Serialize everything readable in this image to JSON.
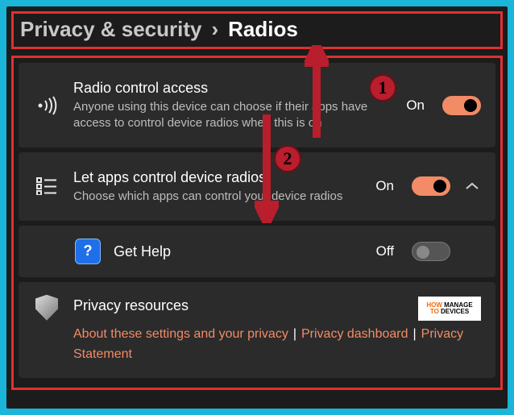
{
  "breadcrumb": {
    "parent": "Privacy & security",
    "separator": "›",
    "current": "Radios"
  },
  "rows": {
    "radio_access": {
      "title": "Radio control access",
      "sub": "Anyone using this device can choose if their apps have access to control device radios when this is on",
      "state_label": "On"
    },
    "let_apps": {
      "title": "Let apps control device radios",
      "sub": "Choose which apps can control your device radios",
      "state_label": "On"
    },
    "get_help": {
      "title": "Get Help",
      "state_label": "Off"
    },
    "resources": {
      "title": "Privacy resources",
      "link1": "About these settings and your privacy",
      "link2": "Privacy dashboard",
      "link3": "Privacy Statement"
    }
  },
  "watermark": {
    "line1_a": "HOW",
    "line1_b": "MANAGE",
    "line2_a": "TO",
    "line2_b": "DEVICES"
  },
  "annotations": {
    "num1": "1",
    "num2": "2"
  }
}
